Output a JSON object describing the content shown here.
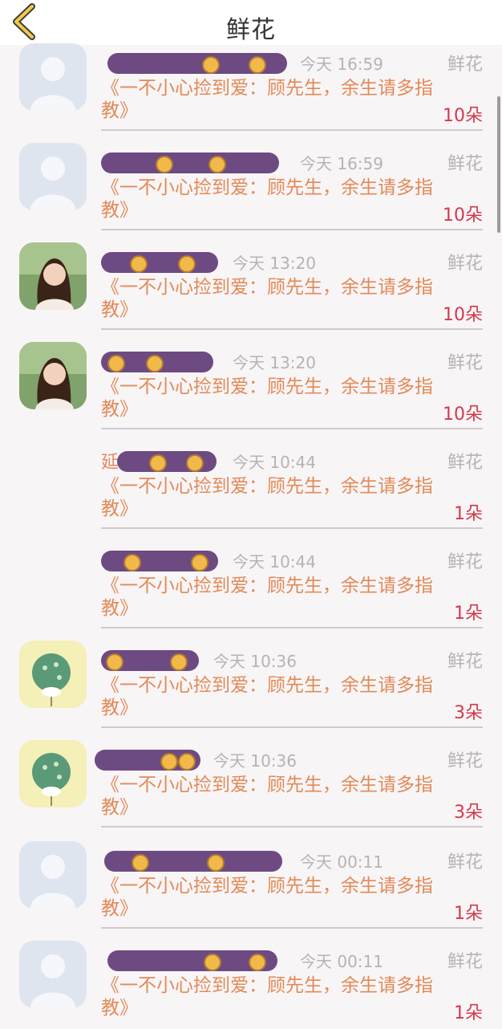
{
  "header": {
    "title": "鲜花",
    "back_icon": "chevron-left-icon"
  },
  "colors": {
    "accent": "#e28a57",
    "count": "#d23a4a",
    "meta": "#b8b2b5",
    "back": "#f2c94c"
  },
  "items": [
    {
      "user": "",
      "time": "今天 16:59",
      "type": "鲜花",
      "book": "《一不小心捡到爱：顾先生，余生请多指教》",
      "count": "10朵",
      "avatar": "default"
    },
    {
      "user": "",
      "time": "今天 16:59",
      "type": "鲜花",
      "book": "《一不小心捡到爱：顾先生，余生请多指教》",
      "count": "10朵",
      "avatar": "default"
    },
    {
      "user": "",
      "time": "今天 13:20",
      "type": "鲜花",
      "book": "《一不小心捡到爱：顾先生，余生请多指教》",
      "count": "10朵",
      "avatar": "photo"
    },
    {
      "user": "",
      "time": "今天 13:20",
      "type": "鲜花",
      "book": "《一不小心捡到爱：顾先生，余生请多指教》",
      "count": "10朵",
      "avatar": "photo"
    },
    {
      "user": "延",
      "time": "今天 10:44",
      "type": "鲜花",
      "book": "《一不小心捡到爱：顾先生，余生请多指教》",
      "count": "1朵",
      "avatar": "none"
    },
    {
      "user": "",
      "time": "今天 10:44",
      "type": "鲜花",
      "book": "《一不小心捡到爱：顾先生，余生请多指教》",
      "count": "1朵",
      "avatar": "none"
    },
    {
      "user": "",
      "time": "今天 10:36",
      "type": "鲜花",
      "book": "《一不小心捡到爱：顾先生，余生请多指教》",
      "count": "3朵",
      "avatar": "hedgehog"
    },
    {
      "user": "",
      "time": "今天 10:36",
      "type": "鲜花",
      "book": "《一不小心捡到爱：顾先生，余生请多指教》",
      "count": "3朵",
      "avatar": "hedgehog"
    },
    {
      "user": "",
      "time": "今天 00:11",
      "type": "鲜花",
      "book": "《一不小心捡到爱：顾先生，余生请多指教》",
      "count": "1朵",
      "avatar": "default"
    },
    {
      "user": "",
      "time": "今天 00:11",
      "type": "鲜花",
      "book": "《一不小心捡到爱：顾先生，余生请多指教》",
      "count": "1朵",
      "avatar": "default"
    }
  ]
}
